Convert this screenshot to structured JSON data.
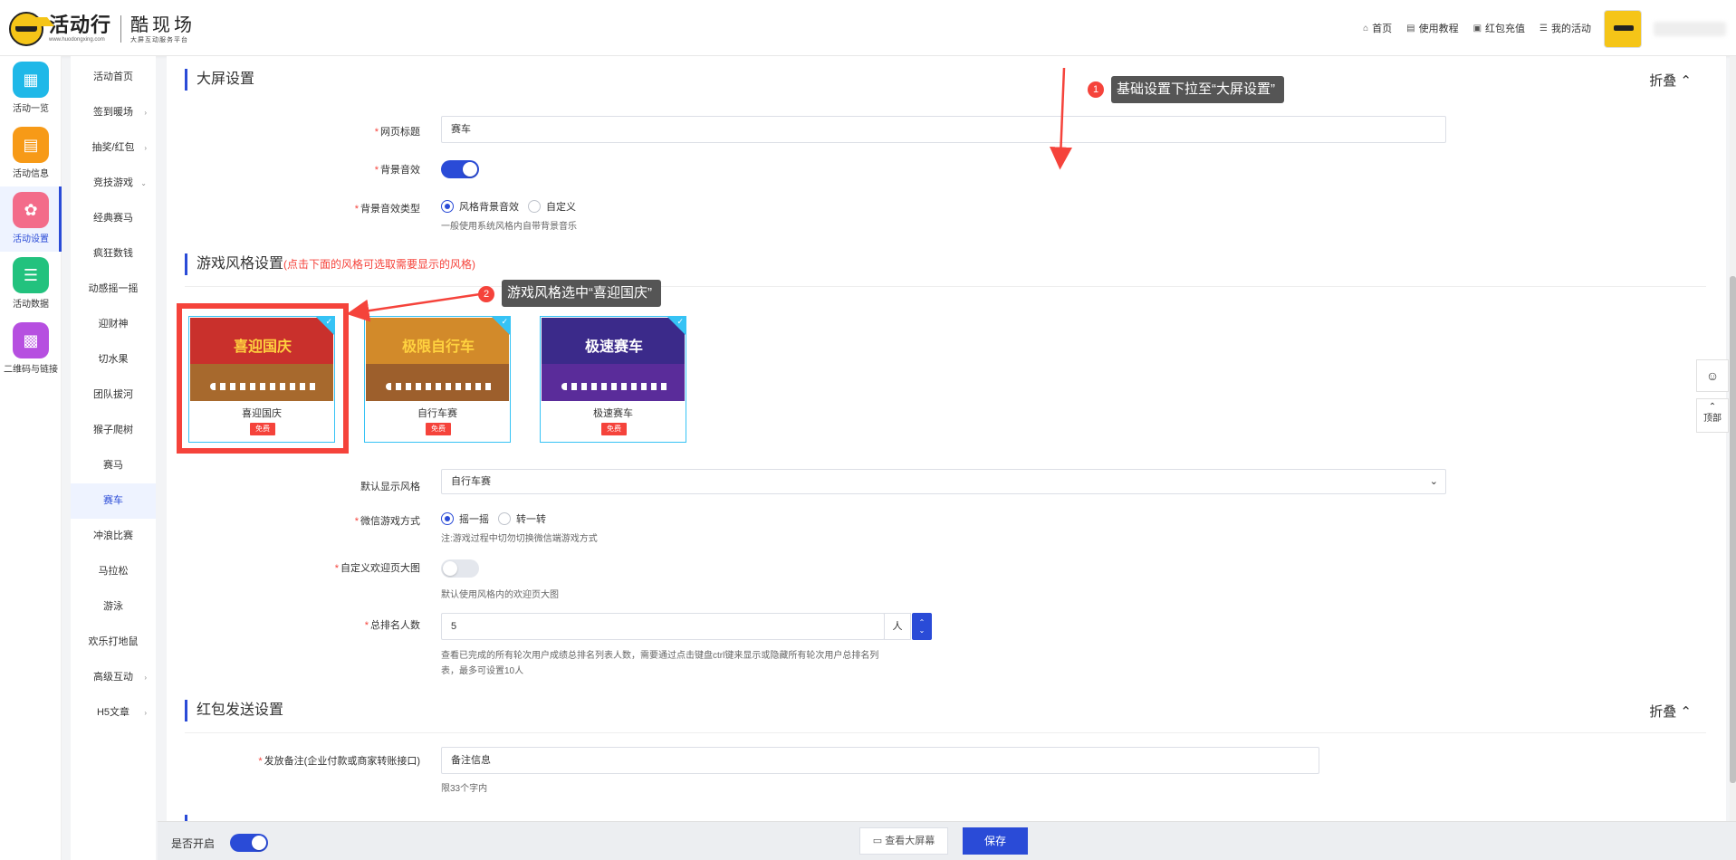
{
  "header": {
    "logo_main": "活动行",
    "logo_url": "www.huodongxing.com",
    "brand_main": "酷现场",
    "brand_sub": "大屏互动服务平台",
    "nav": [
      {
        "icon": "home-icon",
        "label": "首页"
      },
      {
        "icon": "book-icon",
        "label": "使用教程"
      },
      {
        "icon": "redpacket-icon",
        "label": "红包充值"
      },
      {
        "icon": "list-icon",
        "label": "我的活动"
      }
    ],
    "avatar_label": "活动行"
  },
  "iconbar": [
    {
      "label": "活动一览",
      "color": "#1fb8e8",
      "icon": "grid-icon"
    },
    {
      "label": "活动信息",
      "color": "#f79a17",
      "icon": "document-icon"
    },
    {
      "label": "活动设置",
      "color": "#f36c8a",
      "icon": "gear-icon",
      "active": true
    },
    {
      "label": "活动数据",
      "color": "#22c27e",
      "icon": "database-icon"
    },
    {
      "label": "二维码与链接",
      "color": "#b64fe0",
      "icon": "qrcode-icon"
    }
  ],
  "menu": [
    {
      "label": "活动首页"
    },
    {
      "label": "签到暖场",
      "arrow": "›"
    },
    {
      "label": "抽奖/红包",
      "arrow": "›"
    },
    {
      "label": "竞技游戏",
      "arrow": "⌄"
    },
    {
      "label": "经典赛马"
    },
    {
      "label": "疯狂数钱"
    },
    {
      "label": "动感摇一摇"
    },
    {
      "label": "迎财神"
    },
    {
      "label": "切水果"
    },
    {
      "label": "团队拔河"
    },
    {
      "label": "猴子爬树"
    },
    {
      "label": "赛马"
    },
    {
      "label": "赛车",
      "active": true
    },
    {
      "label": "冲浪比赛"
    },
    {
      "label": "马拉松"
    },
    {
      "label": "游泳"
    },
    {
      "label": "欢乐打地鼠"
    },
    {
      "label": "高级互动",
      "arrow": "›"
    },
    {
      "label": "H5文章",
      "arrow": "›"
    }
  ],
  "screen_settings": {
    "title": "大屏设置",
    "fold_label": "折叠",
    "page_title_label": "网页标题",
    "page_title_value": "赛车",
    "bg_sound_label": "背景音效",
    "bg_sound_on": true,
    "bg_sound_type_label": "背景音效类型",
    "bg_sound_options": [
      "风格背景音效",
      "自定义"
    ],
    "bg_sound_help": "一般使用系统风格内自带背景音乐"
  },
  "game_style": {
    "title": "游戏风格设置",
    "hint": "(点击下面的风格可选取需要显示的风格)",
    "cards": [
      {
        "name": "喜迎国庆",
        "badge": "免费",
        "thumb_text": "喜迎国庆",
        "sky": "#c9302c",
        "ground": "#a7692d",
        "text_color": "#ffd23f"
      },
      {
        "name": "自行车赛",
        "badge": "免费",
        "thumb_text": "极限自行车",
        "sky": "#d28a2a",
        "ground": "#9d5f2c",
        "text_color": "#ffd23f"
      },
      {
        "name": "极速赛车",
        "badge": "免费",
        "thumb_text": "极速赛车",
        "sky": "#3b2a8a",
        "ground": "#5a2c9a",
        "text_color": "#ffffff"
      }
    ],
    "default_style_label": "默认显示风格",
    "default_style_value": "自行车赛",
    "wechat_mode_label": "微信游戏方式",
    "wechat_mode_options": [
      "摇一摇",
      "转一转"
    ],
    "wechat_mode_help": "注:游戏过程中切勿切换微信端游戏方式",
    "custom_welcome_label": "自定义欢迎页大图",
    "custom_welcome_on": false,
    "custom_welcome_help": "默认使用风格内的欢迎页大图",
    "rank_label": "总排名人数",
    "rank_value": "5",
    "rank_unit": "人",
    "rank_help_1": "查看已完成的所有轮次用户成绩总排名列表人数，需要通过点击键盘ctrl键来显示或隐藏所有轮次用户总排名列",
    "rank_help_2": "表，最多可设置10人"
  },
  "redpacket": {
    "title": "红包发送设置",
    "fold_label": "折叠",
    "note_label": "发放备注(企业付款或商家转账接口)",
    "note_value": "备注信息",
    "note_help": "限33个字内"
  },
  "annotations": {
    "step1_num": "1",
    "step1_text": "基础设置下拉至“大屏设置”",
    "step2_num": "2",
    "step2_text": "游戏风格选中“喜迎国庆”"
  },
  "bottom": {
    "enable_label": "是否开启",
    "enable_on": true,
    "view_button": "查看大屏幕",
    "save_button": "保存"
  },
  "floating": {
    "service_icon": "customer-service-icon",
    "top_line1": "⌃",
    "top_line2": "顶部"
  }
}
